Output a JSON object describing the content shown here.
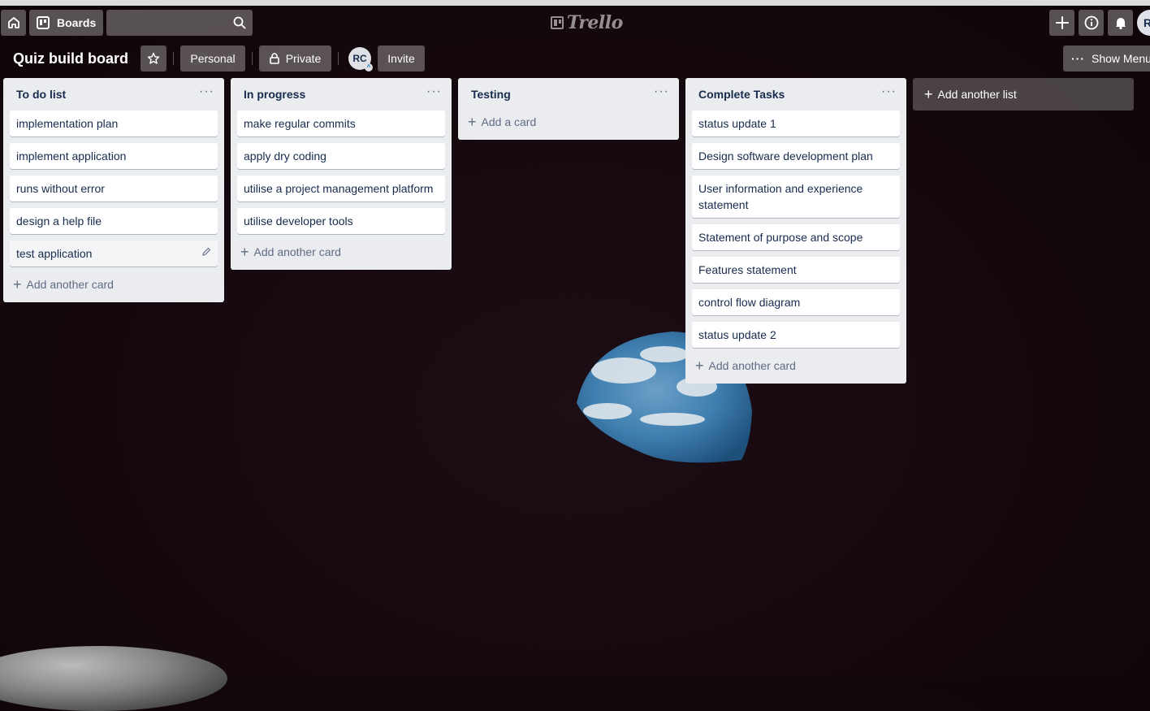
{
  "topnav": {
    "home_icon": "home-icon",
    "boards_label": "Boards",
    "search_placeholder": "",
    "logo_text": "Trello",
    "user_initial": "R"
  },
  "board": {
    "title": "Quiz build board",
    "team_label": "Personal",
    "visibility_label": "Private",
    "member_initials": "RC",
    "invite_label": "Invite",
    "show_menu_label": "Show Menu"
  },
  "lists": [
    {
      "title": "To do list",
      "cards": [
        "implementation plan",
        "implement application",
        "runs without error",
        "design a help file",
        "test application"
      ],
      "add_label": "Add another card"
    },
    {
      "title": "In progress",
      "cards": [
        "make regular commits",
        "apply dry coding",
        "utilise a project management platform",
        "utilise developer tools"
      ],
      "add_label": "Add another card"
    },
    {
      "title": "Testing",
      "cards": [],
      "add_label": "Add a card"
    },
    {
      "title": "Complete Tasks",
      "cards": [
        "status update 1",
        "Design software development plan",
        "User information and experience statement",
        "Statement of purpose and scope",
        "Features statement",
        "control flow diagram",
        "status update 2"
      ],
      "add_label": "Add another card"
    }
  ],
  "add_list_label": "Add another list",
  "colors": {
    "background": "#16090f",
    "list_bg": "#ebecf0",
    "card_text": "#172b4d"
  }
}
